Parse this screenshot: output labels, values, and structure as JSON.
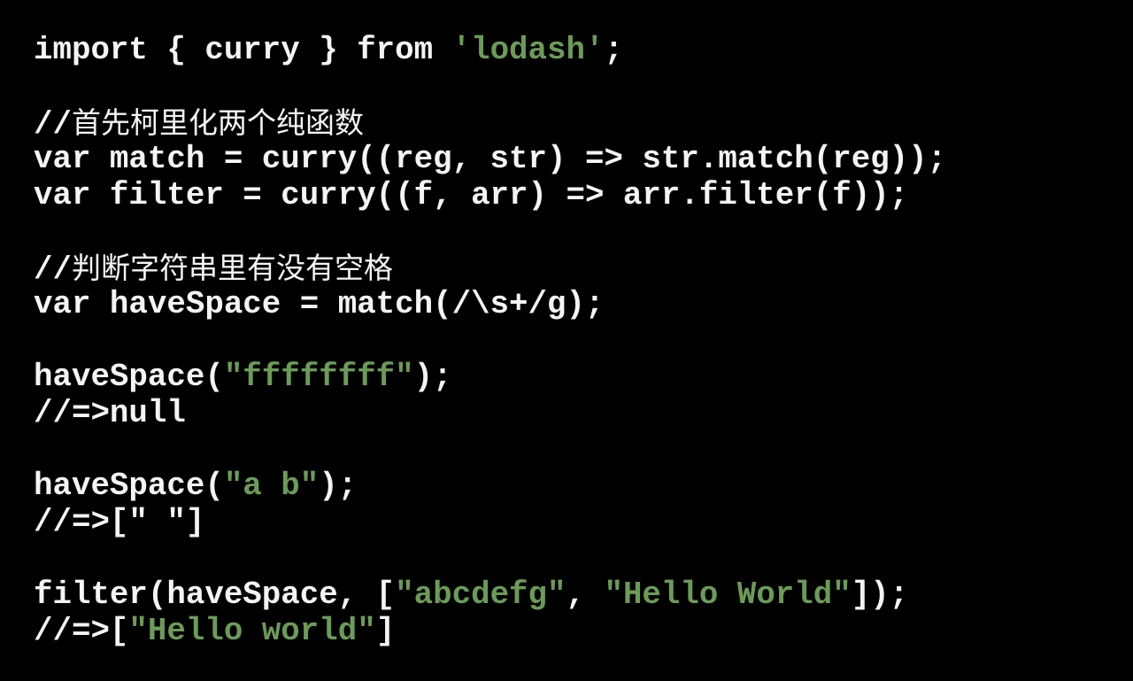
{
  "colors": {
    "background": "#000000",
    "text": "#f4f4f4",
    "string": "#6c9b58"
  },
  "code_lines": [
    [
      {
        "t": "import { curry } from ",
        "c": "p"
      },
      {
        "t": "'lodash'",
        "c": "s"
      },
      {
        "t": ";",
        "c": "p"
      }
    ],
    [],
    [
      {
        "t": "//",
        "c": "p"
      },
      {
        "t": "首先柯里化两个纯函数",
        "c": "cm"
      }
    ],
    [
      {
        "t": "var match = curry((reg, str) => str.match(reg));",
        "c": "p"
      }
    ],
    [
      {
        "t": "var filter = curry((f, arr) => arr.filter(f));",
        "c": "p"
      }
    ],
    [],
    [
      {
        "t": "//",
        "c": "p"
      },
      {
        "t": "判断字符串里有没有空格",
        "c": "cm"
      }
    ],
    [
      {
        "t": "var haveSpace = match(/\\s+/g);",
        "c": "p"
      }
    ],
    [],
    [
      {
        "t": "haveSpace(",
        "c": "p"
      },
      {
        "t": "\"ffffffff\"",
        "c": "s"
      },
      {
        "t": ");",
        "c": "p"
      }
    ],
    [
      {
        "t": "//=>null",
        "c": "p"
      }
    ],
    [],
    [
      {
        "t": "haveSpace(",
        "c": "p"
      },
      {
        "t": "\"a b\"",
        "c": "s"
      },
      {
        "t": ");",
        "c": "p"
      }
    ],
    [
      {
        "t": "//=>[\" \"]",
        "c": "p"
      }
    ],
    [],
    [
      {
        "t": "filter(haveSpace, [",
        "c": "p"
      },
      {
        "t": "\"abcdefg\"",
        "c": "s"
      },
      {
        "t": ", ",
        "c": "p"
      },
      {
        "t": "\"Hello World\"",
        "c": "s"
      },
      {
        "t": "]);",
        "c": "p"
      }
    ],
    [
      {
        "t": "//=>[",
        "c": "p"
      },
      {
        "t": "\"Hello world\"",
        "c": "s"
      },
      {
        "t": "]",
        "c": "p"
      }
    ]
  ]
}
